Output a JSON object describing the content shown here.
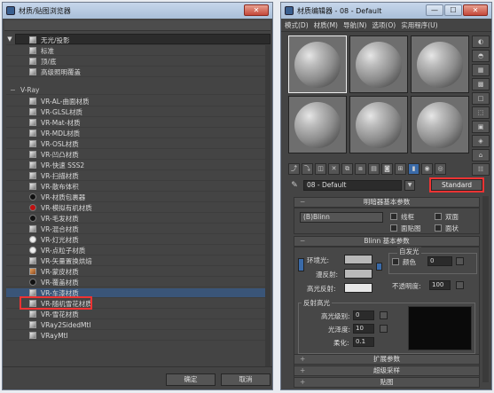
{
  "browser": {
    "title": "材质/贴图浏览器",
    "close_label": "✕",
    "rows": [
      {
        "label": "无光/投影",
        "swatch": "gr",
        "top": 0
      },
      {
        "label": "标准",
        "swatch": "gr"
      },
      {
        "label": "顶/底",
        "swatch": "gr"
      },
      {
        "label": "高级照明覆盖",
        "swatch": "gr"
      }
    ],
    "section_title": "V-Ray",
    "vray_items": [
      {
        "label": "VR-AL-曲面材质",
        "swatch": "gr"
      },
      {
        "label": "VR-GLSL材质",
        "swatch": "gr"
      },
      {
        "label": "VR-Mat-材质",
        "swatch": "gr"
      },
      {
        "label": "VR-MDL材质",
        "swatch": "gr"
      },
      {
        "label": "VR-OSL材质",
        "swatch": "gr"
      },
      {
        "label": "VR-凹凸材质",
        "swatch": "gr"
      },
      {
        "label": "VR-快速 SSS2",
        "swatch": "gr"
      },
      {
        "label": "VR-扫描材质",
        "swatch": "gr"
      },
      {
        "label": "VR-散布体积",
        "swatch": "gr"
      },
      {
        "label": "VR-材质包裹器",
        "swatch": "dk"
      },
      {
        "label": "VR-模拟有机材质",
        "swatch": "rd"
      },
      {
        "label": "VR-毛发材质",
        "swatch": "dk"
      },
      {
        "label": "VR-混合材质",
        "swatch": "gr"
      },
      {
        "label": "VR-灯光材质",
        "swatch": "wh"
      },
      {
        "label": "VR-点粒子材质",
        "swatch": "wh"
      },
      {
        "label": "VR-矢量置换烘焙",
        "swatch": "gr"
      },
      {
        "label": "VR-蒙皮材质",
        "swatch": "or"
      },
      {
        "label": "VR-覆盖材质",
        "swatch": "dk"
      },
      {
        "label": "VR-车漆材质",
        "swatch": "gr"
      },
      {
        "label": "VR-随机雪花材质",
        "swatch": "gr"
      },
      {
        "label": "VR-雪花材质",
        "swatch": "gr"
      },
      {
        "label": "VRay2SidedMtl",
        "swatch": "gr"
      },
      {
        "label": "VRayMtl",
        "swatch": "gr"
      }
    ],
    "ok_label": "确定",
    "cancel_label": "取消"
  },
  "editor": {
    "title": "材质编辑器 - 08 - Default",
    "min_label": "—",
    "max_label": "☐",
    "close_label": "✕",
    "menu": [
      "模式(D)",
      "材质(M)",
      "导航(N)",
      "选项(O)",
      "实用程序(U)"
    ],
    "side_tools": [
      "◐",
      "◓",
      "▦",
      "▩",
      "□",
      "⬚",
      "▣",
      "◈",
      "⌂",
      "☷"
    ],
    "h_tools": [
      "⤴",
      "⤵",
      "◫",
      "✕",
      "⧉",
      "⧈",
      "▤",
      "◙",
      "⊞",
      "▮",
      "◉",
      "◎"
    ],
    "material_name": "08 - Default",
    "material_type": "Standard",
    "shader_header": "明暗器基本参数",
    "shader_value": "(B)Blinn",
    "check_wire": "线框",
    "check_two_sided": "双面",
    "check_face_map": "面贴图",
    "check_faceted": "面状",
    "blinn_header": "Blinn 基本参数",
    "self_illum": "自发光",
    "color_label": "颜色",
    "color_value": "0",
    "ambient_label": "环境光:",
    "diffuse_label": "漫反射:",
    "specular_label": "高光反射:",
    "opacity_label": "不透明度:",
    "opacity_value": "100",
    "spec_highlights": "反射高光",
    "spec_level_label": "高光级别:",
    "spec_level_value": "0",
    "gloss_label": "光泽度:",
    "gloss_value": "10",
    "soften_label": "柔化:",
    "soften_value": "0.1",
    "rollout_extended": "扩展参数",
    "rollout_supersampling": "超级采样",
    "rollout_maps": "贴图",
    "rollout_sym": "+"
  }
}
